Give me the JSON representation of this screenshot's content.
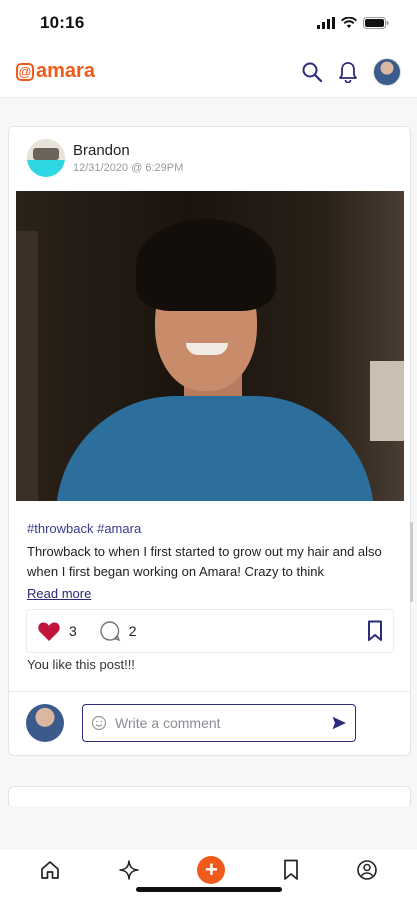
{
  "status_bar": {
    "time": "10:16"
  },
  "app": {
    "brand_name": "amara",
    "brand_mark": "@",
    "brand_color": "#f05a1a",
    "accent_color": "#2b2b7c"
  },
  "header": {
    "icons": [
      "search-icon",
      "bell-icon",
      "profile-avatar"
    ]
  },
  "post": {
    "author": "Brandon",
    "timestamp": "12/31/2020 @ 6:29PM",
    "hashtags": "#throwback #amara",
    "text": "Throwback to when I first started to grow out my hair and also when I first began working on Amara! Crazy to think",
    "read_more": "Read more",
    "like_count": "3",
    "comment_count": "2",
    "liked": true,
    "likes_note": "You like this post!!!"
  },
  "comment": {
    "placeholder": "Write a comment"
  },
  "tabbar": {
    "items": [
      "home-icon",
      "sparkle-icon",
      "add-post-button",
      "bookmark-icon",
      "profile-icon"
    ],
    "add_symbol": "+"
  }
}
